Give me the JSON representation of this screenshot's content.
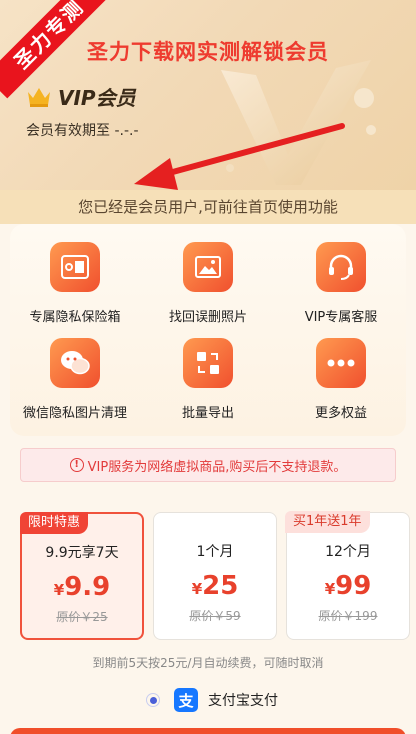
{
  "header": {
    "ribbon": "圣力专测",
    "title": "圣力下载网实测解锁会员",
    "vip_label": "VIP会员",
    "expiry": "会员有效期至 -.-.-"
  },
  "notice": "您已经是会员用户,可前往首页使用功能",
  "features": [
    {
      "label": "专属隐私保险箱",
      "icon": "safe-icon"
    },
    {
      "label": "找回误删照片",
      "icon": "photo-icon"
    },
    {
      "label": "VIP专属客服",
      "icon": "headset-icon"
    },
    {
      "label": "微信隐私图片清理",
      "icon": "chat-icon"
    },
    {
      "label": "批量导出",
      "icon": "export-icon"
    },
    {
      "label": "更多权益",
      "icon": "more-icon"
    }
  ],
  "warning": "VIP服务为网络虚拟商品,购买后不支持退款。",
  "plans": [
    {
      "tag": "限时特惠",
      "name": "9.9元享7天",
      "currency": "¥",
      "price": "9.9",
      "original": "原价￥25"
    },
    {
      "tag": "",
      "name": "1个月",
      "currency": "¥",
      "price": "25",
      "original": "原价￥59"
    },
    {
      "tag": "买1年送1年",
      "name": "12个月",
      "currency": "¥",
      "price": "99",
      "original": "原价￥199"
    }
  ],
  "renew_note": "到期前5天按25元/月自动续费，可随时取消",
  "payment": {
    "label": "支付宝支付",
    "icon_char": "支"
  },
  "colors": {
    "accent": "#f0523c",
    "title_red": "#ee3b2f",
    "alipay": "#1677ff"
  }
}
